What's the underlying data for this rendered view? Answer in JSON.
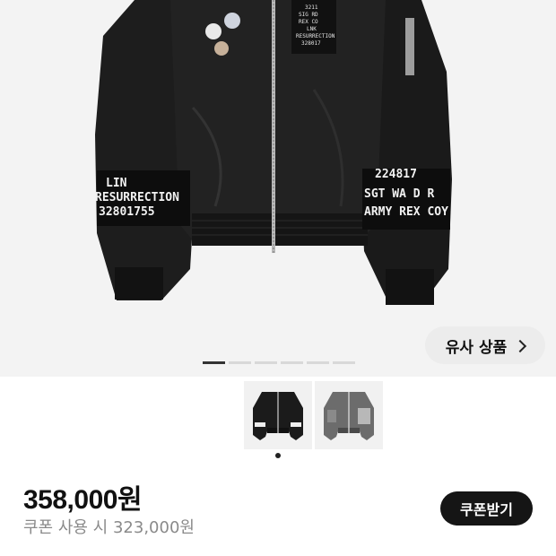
{
  "product_image": {
    "patch_left_lines": [
      "LIN",
      "RESURRECTION",
      "32801755"
    ],
    "patch_right_lines": [
      "224817",
      "SGT WA D R",
      "ARMY REX COY"
    ],
    "chest_patch_lines": [
      "3211",
      "SIG RD",
      "REX CO",
      "LNK",
      "RESURRECTION",
      "328017"
    ]
  },
  "similar_products_label": "유사 상품",
  "pager": {
    "count": 6,
    "active_index": 0
  },
  "thumbnails": [
    {
      "name": "black-bomber-jacket",
      "selected": true
    },
    {
      "name": "grey-bomber-jacket",
      "selected": false
    }
  ],
  "price": "358,000원",
  "coupon_price_text": "쿠폰 사용 시 323,000원",
  "coupon_button_label": "쿠폰받기",
  "colors": {
    "accent_dark": "#151515",
    "muted_text": "#8a8a8a"
  }
}
